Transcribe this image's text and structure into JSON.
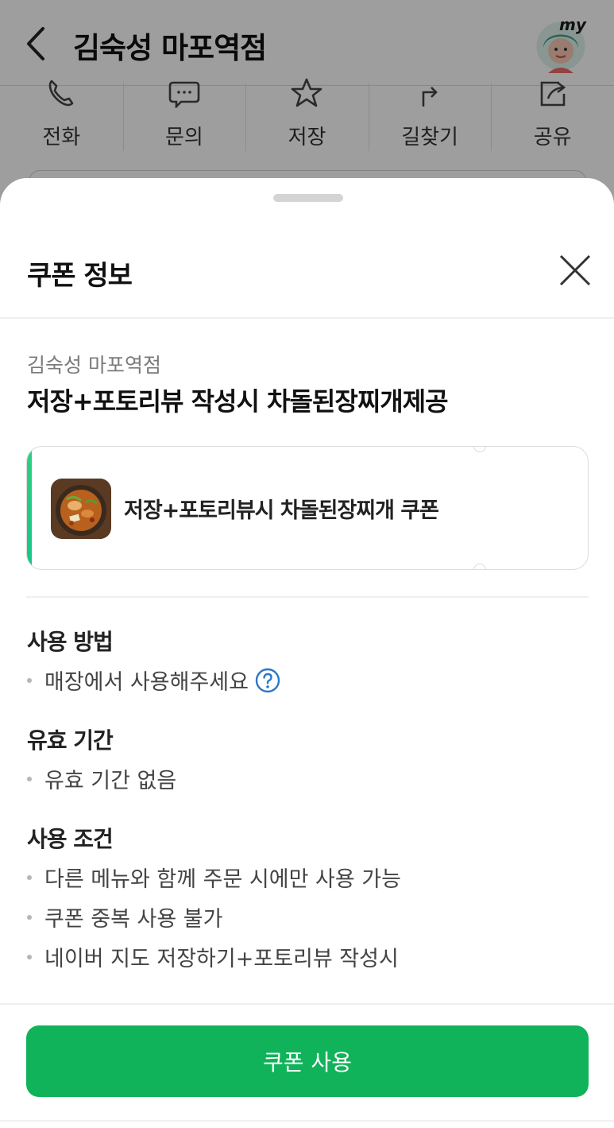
{
  "header": {
    "store_name": "김숙성 마포역점",
    "my_badge": "my",
    "icons": {
      "back": "back-arrow-icon",
      "profile": "my-avatar-icon"
    }
  },
  "actions": [
    {
      "label": "전화",
      "icon": "phone-icon"
    },
    {
      "label": "문의",
      "icon": "chat-icon"
    },
    {
      "label": "저장",
      "icon": "star-icon"
    },
    {
      "label": "길찾기",
      "icon": "directions-icon"
    },
    {
      "label": "공유",
      "icon": "share-icon"
    }
  ],
  "sheet": {
    "title": "쿠폰 정보",
    "close_icon": "close-icon",
    "shop_name": "김숙성 마포역점",
    "headline": "저장+포토리뷰 작성시 차돌된장찌개제공",
    "coupon": {
      "name": "저장+포토리뷰시 차돌된장찌개 쿠폰",
      "image": "stew-thumbnail"
    },
    "sections": [
      {
        "title": "사용 방법",
        "items": [
          "매장에서 사용해주세요"
        ]
      },
      {
        "title": "유효 기간",
        "items": [
          "유효 기간 없음"
        ]
      },
      {
        "title": "사용 조건",
        "items": [
          "다른 메뉴와 함께 주문 시에만 사용 가능",
          "쿠폰 중복 사용 불가",
          "네이버 지도 저장하기+포토리뷰 작성시"
        ]
      }
    ],
    "help_icon": "question-circle-icon",
    "use_button": "쿠폰 사용"
  },
  "colors": {
    "brand_green": "#10b359",
    "accent_bar": "#2fd07e",
    "help_blue": "#2a78c8"
  }
}
